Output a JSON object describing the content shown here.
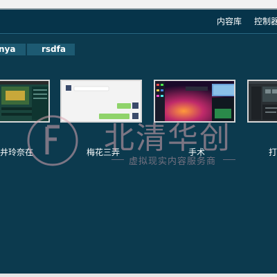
{
  "header": {
    "nav": [
      "内容库",
      "控制器"
    ]
  },
  "tabs": [
    "nya",
    "rsdfa"
  ],
  "items": [
    {
      "caption": "井玲奈在",
      "preview": "app-window-screenshot"
    },
    {
      "caption": "梅花三弄",
      "preview": "chat-window-screenshot"
    },
    {
      "caption": "手术",
      "preview": "desktop-game-screenshot"
    },
    {
      "caption": "打",
      "preview": "editor-screenshot"
    }
  ],
  "watermark": {
    "brand": "北清华创",
    "slogan": "虚拟现实内容服务商"
  },
  "colors": {
    "background": "#0c3a4e",
    "header": "#06344a",
    "tab": "#1d5a72",
    "watermark": "#d9a6b0"
  }
}
